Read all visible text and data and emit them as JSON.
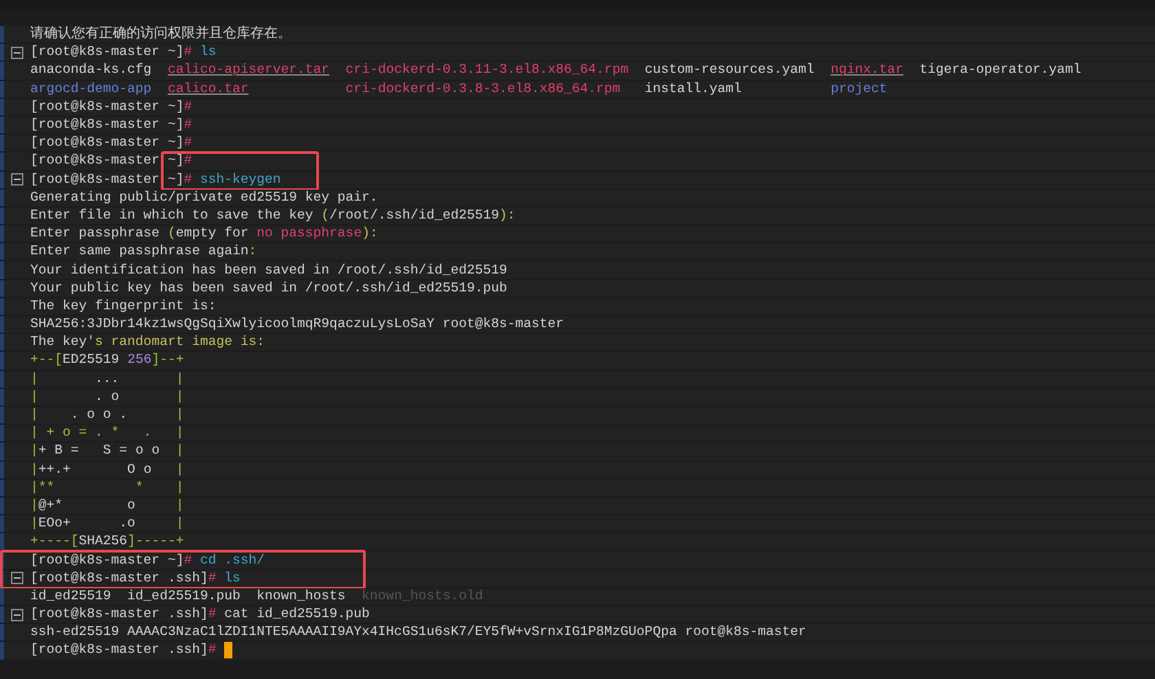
{
  "terminal": {
    "lines": [
      {
        "segments": [
          {
            "t": "请确认您有正确的访问权限并且仓库存在。"
          }
        ]
      },
      {
        "fold": true,
        "segments": [
          {
            "t": "[root@k8s-master ~]"
          },
          {
            "t": "#",
            "color": "#e0406a"
          },
          {
            "t": " ls",
            "color": "#3fa8cf"
          }
        ]
      },
      {
        "segments": [
          {
            "t": "anaconda-ks.cfg  "
          },
          {
            "t": "calico-apiserver.tar",
            "color": "#e0406a",
            "underlined": true
          },
          {
            "t": "  cri-dockerd-0.3.11-3.el8.x86_64.rpm",
            "color": "#e0406a"
          },
          {
            "t": "  custom-resources.yaml  "
          },
          {
            "t": "nginx.tar",
            "color": "#e0406a",
            "underlined": true
          },
          {
            "t": "  tigera-operator.yaml"
          }
        ]
      },
      {
        "segments": [
          {
            "t": "argocd-demo-app  ",
            "color": "#6a7fe0"
          },
          {
            "t": "calico.tar",
            "color": "#e0406a",
            "underlined": true
          },
          {
            "t": "            cri-dockerd-0.3.8-3.el8.x86_64.rpm",
            "color": "#e0406a"
          },
          {
            "t": "   install.yaml           "
          },
          {
            "t": "project",
            "color": "#6a7fe0"
          }
        ]
      },
      {
        "segments": [
          {
            "t": "[root@k8s-master ~]"
          },
          {
            "t": "#",
            "color": "#e0406a"
          }
        ]
      },
      {
        "segments": [
          {
            "t": "[root@k8s-master ~]"
          },
          {
            "t": "#",
            "color": "#e0406a"
          }
        ]
      },
      {
        "segments": [
          {
            "t": "[root@k8s-master ~]"
          },
          {
            "t": "#",
            "color": "#e0406a"
          }
        ]
      },
      {
        "highlighted": true,
        "box_full_width": false,
        "segments": [
          {
            "t": "[root@k8s-master ~]"
          },
          {
            "t": "#",
            "color": "#e0406a"
          }
        ]
      },
      {
        "highlighted": true,
        "box_full_width": false,
        "fold": true,
        "segments": [
          {
            "t": "[root@k8s-master ~]"
          },
          {
            "t": "#",
            "color": "#e0406a"
          },
          {
            "t": " ssh-keygen",
            "color": "#3fa8cf"
          }
        ]
      },
      {
        "segments": [
          {
            "t": "Generating public/private ed25519 key pair."
          }
        ]
      },
      {
        "segments": [
          {
            "t": "Enter file in which to save the key "
          },
          {
            "t": "(",
            "color": "#c8c060"
          },
          {
            "t": "/root/.ssh/id_ed25519"
          },
          {
            "t": "):",
            "color": "#c8c060"
          }
        ]
      },
      {
        "segments": [
          {
            "t": "Enter passphrase "
          },
          {
            "t": "(",
            "color": "#c8c060"
          },
          {
            "t": "empty for "
          },
          {
            "t": "no passphrase",
            "color": "#e0406a"
          },
          {
            "t": "):",
            "color": "#c8c060"
          }
        ]
      },
      {
        "segments": [
          {
            "t": "Enter same passphrase again"
          },
          {
            "t": ":",
            "color": "#c8c060"
          }
        ]
      },
      {
        "segments": [
          {
            "t": "Your identification has been saved in /root/.ssh/id_ed25519"
          }
        ]
      },
      {
        "segments": [
          {
            "t": "Your public key has been saved in /root/.ssh/id_ed25519.pub"
          }
        ]
      },
      {
        "segments": [
          {
            "t": "The key fingerprint is:"
          }
        ]
      },
      {
        "segments": [
          {
            "t": "SHA256:3JDbr14kz1wsQgSqiXwlyicoolmqR9qaczuLysLoSaY root@k8s-master"
          }
        ]
      },
      {
        "segments": [
          {
            "t": "The key"
          },
          {
            "t": "'s randomart image is:",
            "color": "#c8c060"
          }
        ]
      },
      {
        "segments": [
          {
            "t": "+--[",
            "color": "#9ac83a"
          },
          {
            "t": "ED25519 "
          },
          {
            "t": "256",
            "color": "#a78be0"
          },
          {
            "t": "]--+",
            "color": "#9ac83a"
          }
        ]
      },
      {
        "segments": [
          {
            "t": "|",
            "color": "#9ac83a"
          },
          {
            "t": "       ...       "
          },
          {
            "t": "|",
            "color": "#9ac83a"
          }
        ]
      },
      {
        "segments": [
          {
            "t": "|",
            "color": "#9ac83a"
          },
          {
            "t": "       . o       "
          },
          {
            "t": "|",
            "color": "#9ac83a"
          }
        ]
      },
      {
        "segments": [
          {
            "t": "|",
            "color": "#9ac83a"
          },
          {
            "t": "    . o o .      "
          },
          {
            "t": "|",
            "color": "#9ac83a"
          }
        ]
      },
      {
        "segments": [
          {
            "t": "| + o = . *   .   |",
            "color": "#9ac83a"
          }
        ]
      },
      {
        "segments": [
          {
            "t": "|",
            "color": "#9ac83a"
          },
          {
            "t": "+ B =   S = o o  "
          },
          {
            "t": "|",
            "color": "#9ac83a"
          }
        ]
      },
      {
        "segments": [
          {
            "t": "|",
            "color": "#9ac83a"
          },
          {
            "t": "++.+       O o   "
          },
          {
            "t": "|",
            "color": "#9ac83a"
          }
        ]
      },
      {
        "segments": [
          {
            "t": "|**          *    |",
            "color": "#9ac83a"
          }
        ]
      },
      {
        "segments": [
          {
            "t": "|",
            "color": "#9ac83a"
          },
          {
            "t": "@+*        o     "
          },
          {
            "t": "|",
            "color": "#9ac83a"
          }
        ]
      },
      {
        "segments": [
          {
            "t": "|",
            "color": "#9ac83a"
          },
          {
            "t": "EOo+      .o     "
          },
          {
            "t": "|",
            "color": "#9ac83a"
          }
        ]
      },
      {
        "segments": [
          {
            "t": "+----[",
            "color": "#9ac83a"
          },
          {
            "t": "SHA256"
          },
          {
            "t": "]-----+",
            "color": "#9ac83a"
          }
        ]
      },
      {
        "highlighted": true,
        "box_full_width": true,
        "segments": [
          {
            "t": "[root@k8s-master ~]"
          },
          {
            "t": "#",
            "color": "#e0406a"
          },
          {
            "t": " cd .ssh/",
            "color": "#3fa8cf"
          }
        ]
      },
      {
        "highlighted": true,
        "box_full_width": true,
        "fold": true,
        "segments": [
          {
            "t": "[root@k8s-master .ssh]"
          },
          {
            "t": "#",
            "color": "#e0406a"
          },
          {
            "t": " ls",
            "color": "#3fa8cf"
          }
        ]
      },
      {
        "segments": [
          {
            "t": "id_ed25519  id_ed25519.pub  known_hosts  "
          },
          {
            "t": "known_hosts.old",
            "color": "#555555"
          }
        ]
      },
      {
        "fold": true,
        "segments": [
          {
            "t": "[root@k8s-master .ssh]"
          },
          {
            "t": "#",
            "color": "#e0406a"
          },
          {
            "t": " cat id_ed25519.pub"
          }
        ]
      },
      {
        "segments": [
          {
            "t": "ssh-ed25519 AAAAC3NzaC1lZDI1NTE5AAAAII9AYx4IHcGS1u6sK7/EY5fW+vSrnxIG1P8MzGUoPQpa root@k8s-master"
          }
        ]
      },
      {
        "cursor": true,
        "segments": [
          {
            "t": "[root@k8s-master .ssh]"
          },
          {
            "t": "#",
            "color": "#e0406a"
          }
        ]
      }
    ]
  }
}
